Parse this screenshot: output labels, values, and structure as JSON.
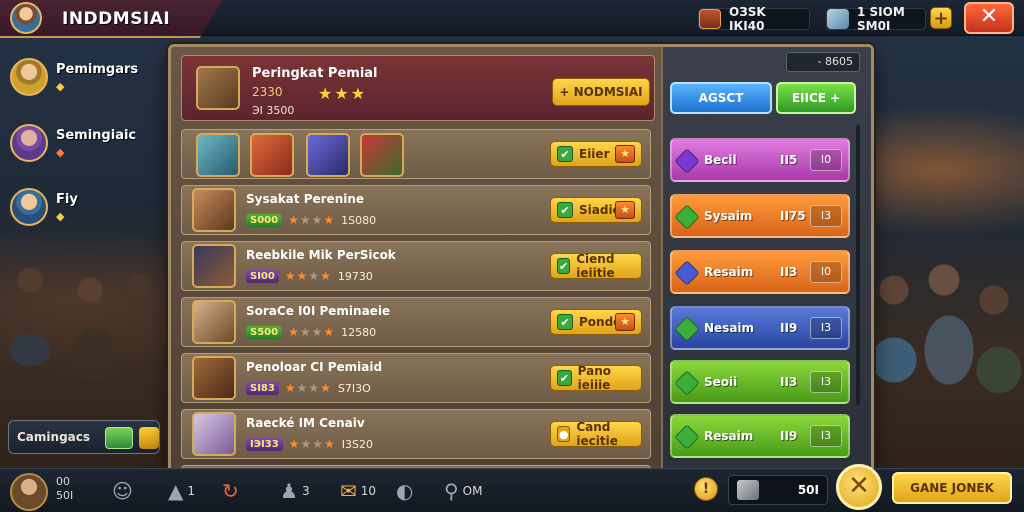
{
  "topbar": {
    "player_name": "INDDMSIAI",
    "resource_1": "OЗSK IКI40",
    "resource_2": "1 SIOM SM0I",
    "plus": "+",
    "close": "✕"
  },
  "sidebar": {
    "items": [
      {
        "label": "Pemimgars",
        "sub": "◆"
      },
      {
        "label": "Semingiaic",
        "sub": "◆"
      },
      {
        "label": "Fiy",
        "sub": "◆"
      }
    ],
    "challenge_label": "Camingacs"
  },
  "panel": {
    "counter": "- 8605",
    "header": {
      "title": "Peringkat Pemial",
      "sub": "2330",
      "sub2": "ЭI 3500",
      "stars": "★★★",
      "button": "+ NODMSIAI"
    },
    "hero_row_button": "Eiier",
    "rows": [
      {
        "name": "Sysakat  Perenine",
        "pill": "S000",
        "score": "1S080",
        "button": "Siadie"
      },
      {
        "name": "Reebkile Mik  PerSicok",
        "pill": "SI00",
        "score": "19730",
        "button": "Ciend ieiitie"
      },
      {
        "name": "SoraCe   I0I Peminaeie",
        "pill": "S500",
        "score": "12580",
        "button": "Pondo"
      },
      {
        "name": "Penoloar   CI Pemiaid",
        "pill": "SI83",
        "score": "S7I3O",
        "button": "Pano ieiiie"
      },
      {
        "name": "Raecké   IM Cenaiv",
        "pill": "IЭI33",
        "score": "I3S20",
        "button": "Cand iecitie"
      }
    ],
    "tabs": {
      "blue": "AGSCT",
      "green": "EIICE +"
    },
    "stats": [
      {
        "label": "Becil",
        "value": "II5",
        "box": "I0",
        "color_top": "#e07ae0",
        "color_bot": "#a83aa8",
        "icon": "#7a3ad0"
      },
      {
        "label": "Sysaim",
        "value": "II75",
        "box": "I3",
        "color_top": "#ff9a3a",
        "color_bot": "#d8641a",
        "icon": "#3ab03a"
      },
      {
        "label": "Resaim",
        "value": "II3",
        "box": "I0",
        "color_top": "#ff9a3a",
        "color_bot": "#d8641a",
        "icon": "#4a5ad0"
      },
      {
        "label": "Nesaim",
        "value": "II9",
        "box": "I3",
        "color_top": "#5a7ad8",
        "color_bot": "#2a44a0",
        "icon": "#3ab03a"
      },
      {
        "label": "Seoii",
        "value": "II3",
        "box": "I3",
        "color_top": "#8ad83a",
        "color_bot": "#4a9a1a",
        "icon": "#3ab03a"
      },
      {
        "label": "Resaim",
        "value": "II9",
        "box": "I3",
        "color_top": "#8ad83a",
        "color_bot": "#4a9a1a",
        "icon": "#3ab03a"
      }
    ]
  },
  "bottombar": {
    "level_top": "00",
    "level_bottom": "50I",
    "items": [
      "1",
      "3",
      "10",
      "OM"
    ],
    "coin": "!",
    "count": "50I",
    "cancel": "✕",
    "game_button": "GANE JONEK"
  }
}
